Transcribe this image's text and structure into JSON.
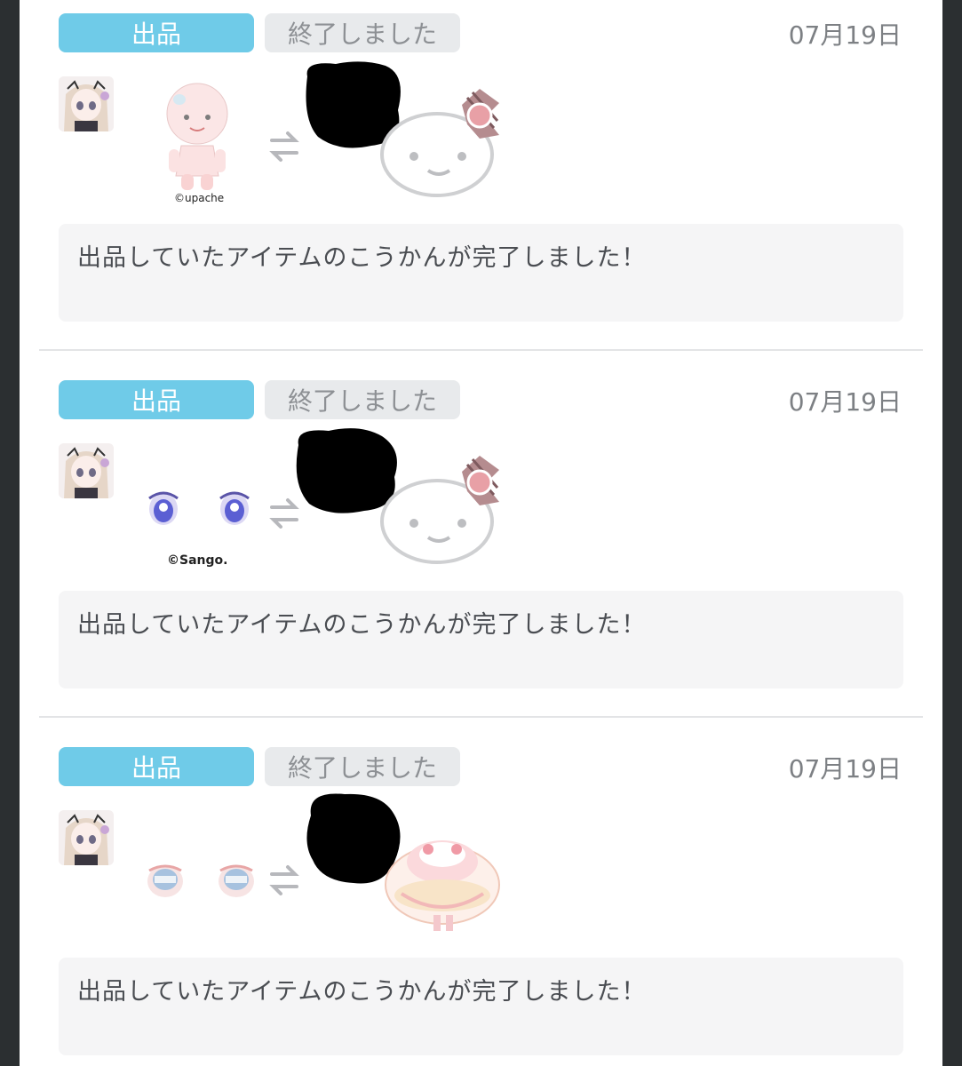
{
  "entries": [
    {
      "type_label": "出品",
      "status_label": "終了しました",
      "date": "07月19日",
      "item_credit": "©upache",
      "item_kind": "body-doll",
      "reward_kind": "face-with-bow",
      "message": "出品していたアイテムのこうかんが完了しました！"
    },
    {
      "type_label": "出品",
      "status_label": "終了しました",
      "date": "07月19日",
      "item_credit": "©Sango.",
      "item_kind": "blue-eyes",
      "reward_kind": "face-with-bow",
      "message": "出品していたアイテムのこうかんが完了しました！"
    },
    {
      "type_label": "出品",
      "status_label": "終了しました",
      "date": "07月19日",
      "item_credit": "",
      "item_kind": "grey-eyes",
      "reward_kind": "cake-dress",
      "message": "出品していたアイテムのこうかんが完了しました！"
    }
  ],
  "icons": {
    "swap": "swap-arrows-icon"
  },
  "colors": {
    "type_badge": "#6fcbe8",
    "status_badge": "#e8eaec",
    "message_bg": "#f5f5f6"
  }
}
